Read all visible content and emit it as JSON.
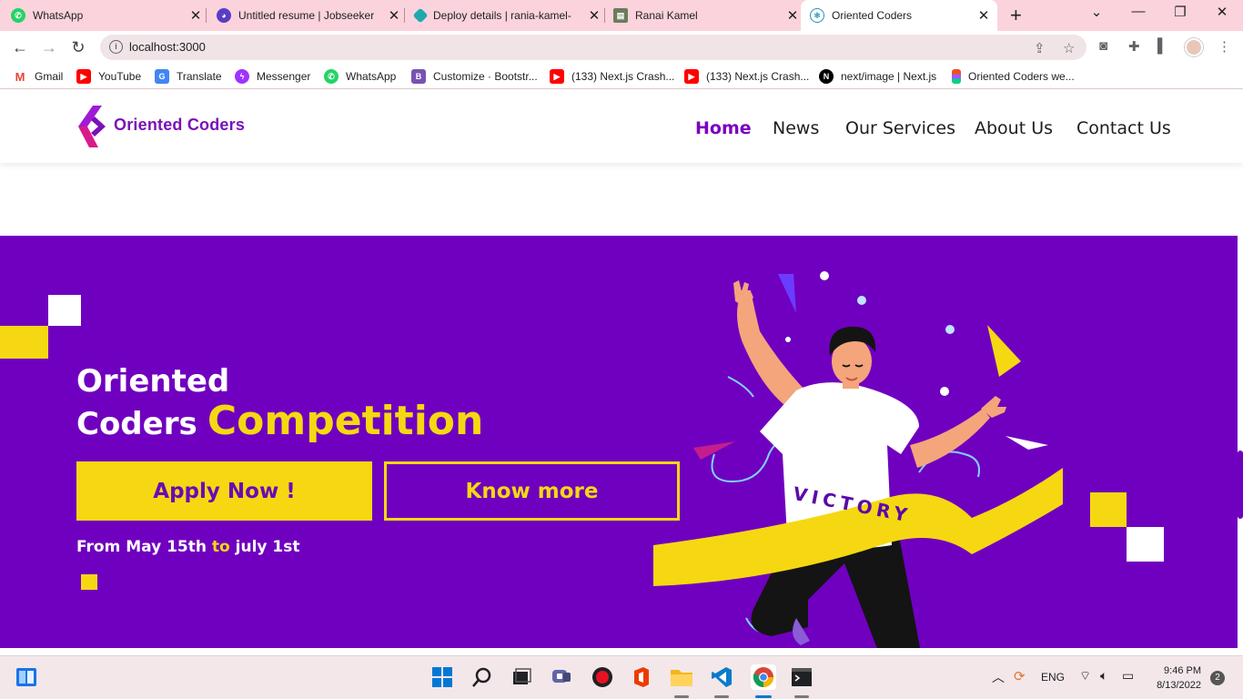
{
  "browser": {
    "tabs": [
      {
        "title": "WhatsApp",
        "icon": "whatsapp-icon",
        "color": "#25d366"
      },
      {
        "title": "Untitled resume | Jobseeker",
        "icon": "jobseeker-icon",
        "color": "#5b3cc4"
      },
      {
        "title": "Deploy details | rania-kamel-",
        "icon": "netlify-icon",
        "color": "#20a8b0"
      },
      {
        "title": "Ranai Kamel",
        "icon": "portfolio-icon",
        "color": "#6b7c5b"
      },
      {
        "title": "Oriented Coders",
        "icon": "react-icon",
        "color": "#61dafb"
      }
    ],
    "url": "localhost:3000",
    "bookmarks": [
      {
        "label": "Gmail",
        "icon": "gmail-icon",
        "color": "#ea4335"
      },
      {
        "label": "YouTube",
        "icon": "youtube-icon",
        "color": "#ff0000"
      },
      {
        "label": "Translate",
        "icon": "translate-icon",
        "color": "#4285f4"
      },
      {
        "label": "Messenger",
        "icon": "messenger-icon",
        "color": "#a033ff"
      },
      {
        "label": "WhatsApp",
        "icon": "whatsapp-icon",
        "color": "#25d366"
      },
      {
        "label": "Customize · Bootstr...",
        "icon": "bootstrap-icon",
        "color": "#7952b3"
      },
      {
        "label": "(133) Next.js Crash...",
        "icon": "youtube-icon",
        "color": "#ff0000"
      },
      {
        "label": "(133) Next.js Crash...",
        "icon": "youtube-icon",
        "color": "#ff0000"
      },
      {
        "label": "next/image | Next.js",
        "icon": "nextjs-icon",
        "color": "#000000"
      },
      {
        "label": "Oriented Coders we...",
        "icon": "figma-icon",
        "color": "#f24e1e"
      }
    ]
  },
  "site": {
    "logo_text": "Oriented Coders",
    "nav": [
      {
        "label": "Home",
        "active": true
      },
      {
        "label": "News",
        "active": false
      },
      {
        "label": "Our Services",
        "active": false
      },
      {
        "label": "About Us",
        "active": false
      },
      {
        "label": "Contact Us",
        "active": false
      }
    ],
    "hero": {
      "title_line1": "Oriented",
      "title_line2": "Coders",
      "title_accent": "Competition",
      "apply_label": "Apply Now !",
      "know_label": "Know more",
      "date_from": "From May 15th",
      "date_to_word": "to",
      "date_to": "july 1st",
      "banner_text": "VICTORY"
    },
    "colors": {
      "primary": "#7000bf",
      "accent": "#f5d812",
      "white": "#ffffff"
    }
  },
  "taskbar": {
    "language": "ENG",
    "time": "9:46 PM",
    "date": "8/13/2022",
    "notifications": "2"
  }
}
